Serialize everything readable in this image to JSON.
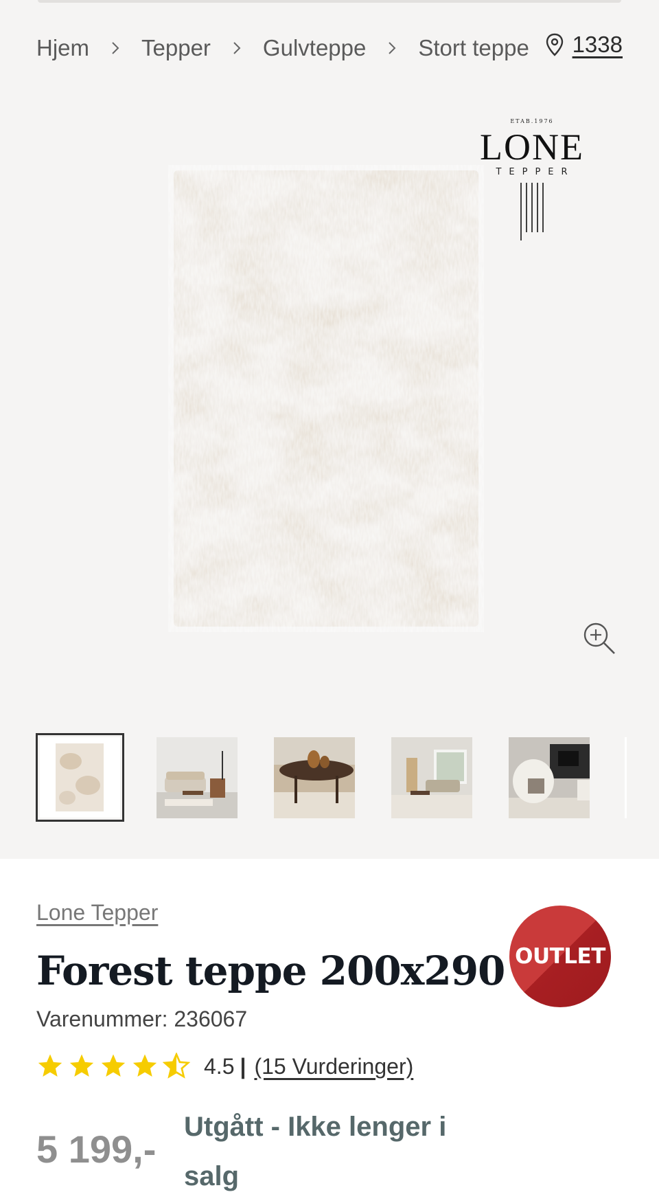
{
  "breadcrumb": {
    "items": [
      "Hjem",
      "Tepper",
      "Gulvteppe",
      "Stort teppe"
    ]
  },
  "store": {
    "icon": "location-pin-icon",
    "label": "1338"
  },
  "brand_logo": {
    "etab": "ETAB.1976",
    "name": "LONE",
    "sub": "TEPPER"
  },
  "gallery": {
    "thumbnails": [
      "rug-flat",
      "living-room-sofa",
      "coffee-table-vase",
      "bright-living-room",
      "armchair-fireplace"
    ],
    "active_index": 0
  },
  "product": {
    "brand": "Lone Tepper",
    "title": "Forest teppe 200x290",
    "sku": "Varenummer: 236067",
    "rating": 4.5,
    "rating_text": "4.5",
    "reviews": "(15 Vurderinger)",
    "badge": "OUTLET",
    "price": "5 199,-",
    "status": "Utgått - Ikke lenger i salg"
  },
  "colors": {
    "star": "#f6cc00",
    "badge": "#c0282c",
    "status": "#56686a"
  }
}
